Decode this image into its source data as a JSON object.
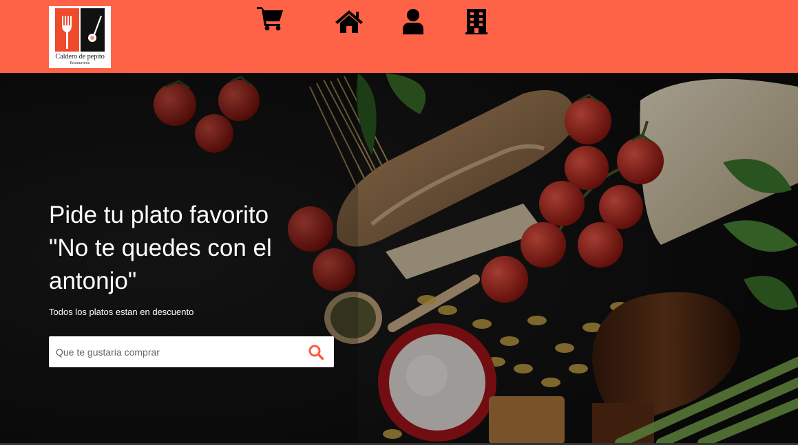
{
  "brand": {
    "name": "Caldero de pepito",
    "tagline": "Restaurante"
  },
  "nav": {
    "items": [
      {
        "icon": "cart-icon"
      },
      {
        "icon": "home-icon"
      },
      {
        "icon": "user-icon"
      },
      {
        "icon": "building-icon"
      }
    ]
  },
  "hero": {
    "title_line1": "Pide tu plato favorito",
    "title_line2": "\"No te quedes con el",
    "title_line3": "antonjo\"",
    "subtitle": "Todos los platos estan en descuento"
  },
  "search": {
    "placeholder": "Que te gustaria comprar",
    "value": "",
    "button_icon": "search-icon"
  },
  "colors": {
    "header_bg": "#ff6347",
    "accent": "#ff5a3c",
    "text_on_hero": "#ffffff"
  }
}
